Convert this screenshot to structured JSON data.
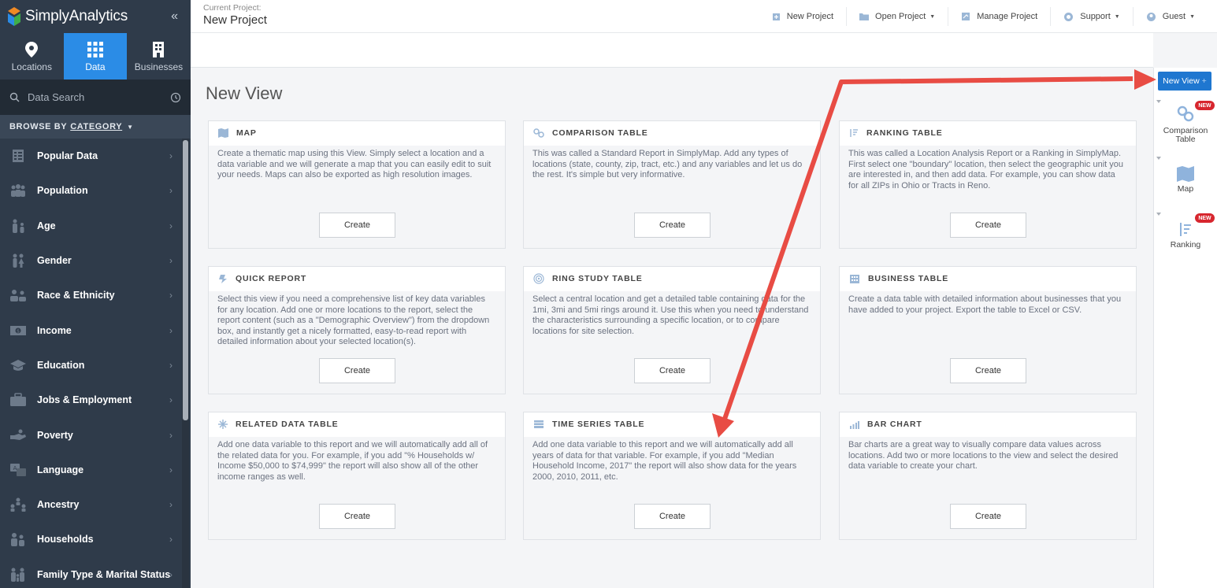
{
  "app": {
    "name": "SimplyAnalytics"
  },
  "sidebar": {
    "tabs": [
      {
        "label": "Locations",
        "icon": "map-pin-icon"
      },
      {
        "label": "Data",
        "icon": "grid-icon"
      },
      {
        "label": "Businesses",
        "icon": "building-icon"
      }
    ],
    "search_placeholder": "Data Search",
    "browse": {
      "prefix": "BROWSE BY",
      "mode": "CATEGORY"
    },
    "categories": [
      "Popular Data",
      "Population",
      "Age",
      "Gender",
      "Race & Ethnicity",
      "Income",
      "Education",
      "Jobs & Employment",
      "Poverty",
      "Language",
      "Ancestry",
      "Households",
      "Family Type & Marital Status"
    ]
  },
  "topbar": {
    "project_label": "Current Project:",
    "project_name": "New Project",
    "nav": {
      "new_project": "New Project",
      "open_project": "Open Project",
      "manage_project": "Manage Project",
      "support": "Support",
      "guest": "Guest"
    }
  },
  "main": {
    "title": "New View",
    "create_label": "Create",
    "cards": [
      {
        "title": "MAP",
        "text": "Create a thematic map using this View. Simply select a location and a data variable and we will generate a map that you can easily edit to suit your needs. Maps can also be exported as high resolution images."
      },
      {
        "title": "COMPARISON TABLE",
        "text": "This was called a Standard Report in SimplyMap. Add any types of locations (state, county, zip, tract, etc.) and any variables and let us do the rest. It's simple but very informative."
      },
      {
        "title": "RANKING TABLE",
        "text": "This was called a Location Analysis Report or a Ranking in SimplyMap. First select one \"boundary\" location, then select the geographic unit you are interested in, and then add data. For example, you can show data for all ZIPs in Ohio or Tracts in Reno."
      },
      {
        "title": "QUICK REPORT",
        "text": "Select this view if you need a comprehensive list of key data variables for any location. Add one or more locations to the report, select the report content (such as a \"Demographic Overview\") from the dropdown box, and instantly get a nicely formatted, easy-to-read report with detailed information about your selected location(s)."
      },
      {
        "title": "RING STUDY TABLE",
        "text": "Select a central location and get a detailed table containing data for the 1mi, 3mi and 5mi rings around it. Use this when you need to understand the characteristics surrounding a specific location, or to compare locations for site selection."
      },
      {
        "title": "BUSINESS TABLE",
        "text": "Create a data table with detailed information about businesses that you have added to your project. Export the table to Excel or CSV."
      },
      {
        "title": "RELATED DATA TABLE",
        "text": "Add one data variable to this report and we will automatically add all of the related data for you. For example, if you add \"% Households w/ Income $50,000 to $74,999\" the report will also show all of the other income ranges as well."
      },
      {
        "title": "TIME SERIES TABLE",
        "text": "Add one data variable to this report and we will automatically add all years of data for that variable. For example, if you add \"Median Household Income, 2017\" the report will also show data for the years 2000, 2010, 2011, etc."
      },
      {
        "title": "BAR CHART",
        "text": "Bar charts are a great way to visually compare data values across locations. Add two or more locations to the view and select the desired data variable to create your chart."
      }
    ]
  },
  "rpanel": {
    "new_view": "New View",
    "plus": "+",
    "badge": "NEW",
    "items": [
      {
        "label": "Comparison Table"
      },
      {
        "label": "Map"
      },
      {
        "label": "Ranking"
      }
    ]
  },
  "colors": {
    "accent": "#2b8ce6",
    "sidebar": "#2f3b4a",
    "badge": "#d7262e",
    "arrow": "#e84c44"
  }
}
